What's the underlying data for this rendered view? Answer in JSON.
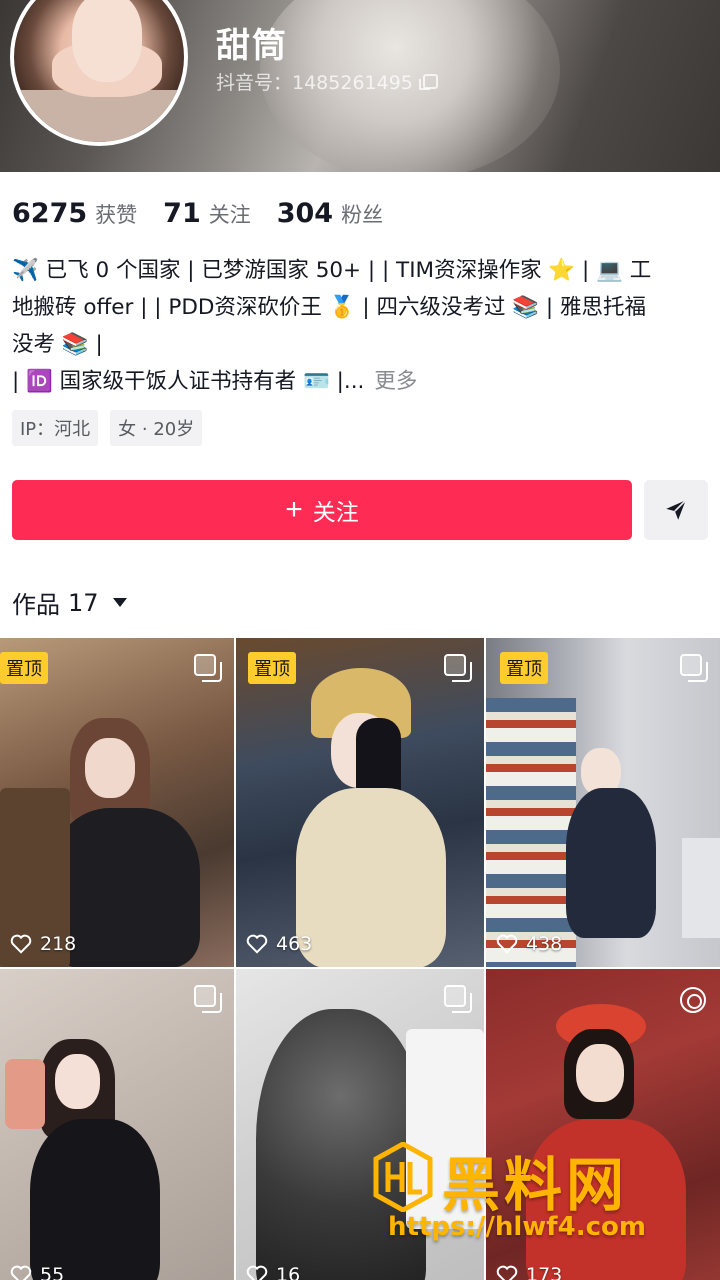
{
  "profile": {
    "nickname": "甜筒",
    "douyin_id": "抖音号：1485261495"
  },
  "stats": [
    {
      "value": "6275",
      "label": "获赞"
    },
    {
      "value": "71",
      "label": "关注"
    },
    {
      "value": "304",
      "label": "粉丝"
    }
  ],
  "bio": {
    "line1": "✈️ 已飞 0 个国家 | 已梦游国家 50+ | | TIM资深操作家 ⭐ | 💻 工",
    "line2": "地搬砖 offer | | PDD资深砍价王 🥇 | 四六级没考过 📚 | 雅思托福",
    "line3": "没考 📚 |",
    "line4": "| 🆔 国家级干饭人证书持有者 🪪 |...",
    "more": "更多"
  },
  "tags": [
    "IP：河北",
    "女 · 20岁"
  ],
  "actions": {
    "follow_plus": "+",
    "follow_label": "关注"
  },
  "works": {
    "label": "作品",
    "count": "17"
  },
  "grid": [
    {
      "pinned": "置顶",
      "likes": "218",
      "icon": "multi-image-icon"
    },
    {
      "pinned": "置顶",
      "likes": "463",
      "icon": "multi-image-icon"
    },
    {
      "pinned": "置顶",
      "likes": "438",
      "icon": "multi-image-icon"
    },
    {
      "pinned": "",
      "likes": "55",
      "icon": "multi-image-icon"
    },
    {
      "pinned": "",
      "likes": "16",
      "icon": "multi-image-icon"
    },
    {
      "pinned": "",
      "likes": "173",
      "icon": "live-photo-icon"
    }
  ],
  "watermark": {
    "title": "黑料网",
    "url": "https://hlwf4.com"
  },
  "colors": {
    "accent": "#fe2c55",
    "pin_badge": "#fecc2d",
    "watermark": "#ffb400"
  }
}
